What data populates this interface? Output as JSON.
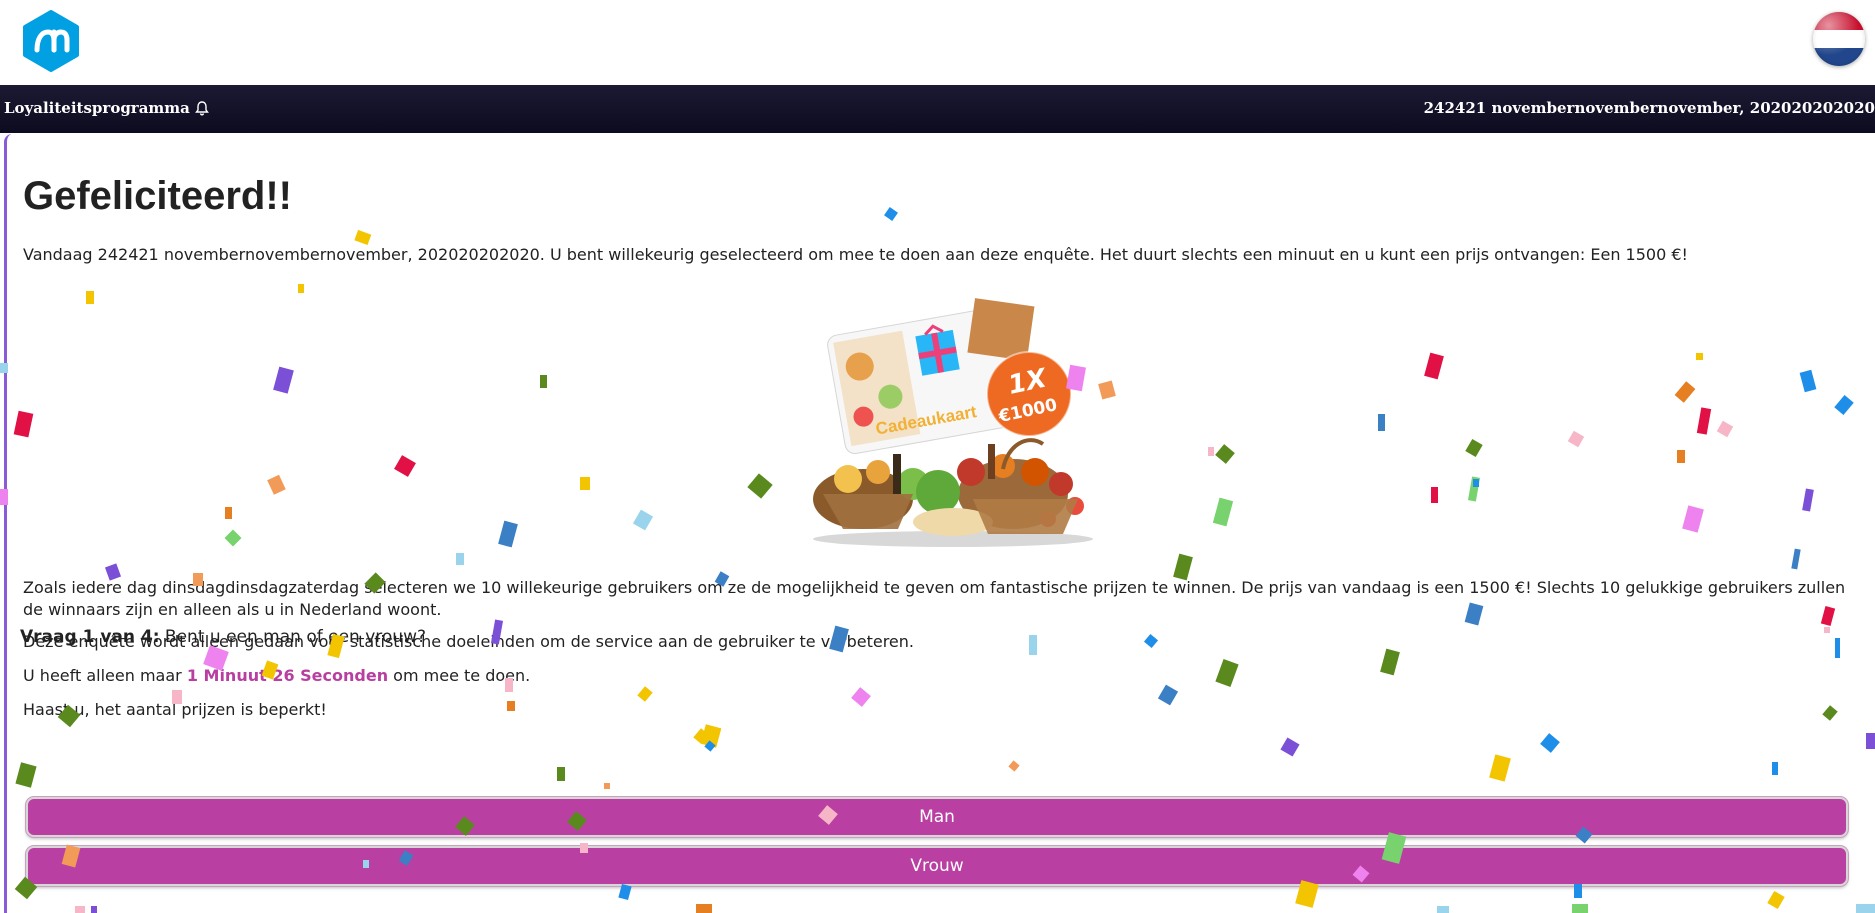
{
  "header": {
    "logo_icon": "albert-heijn-logo-icon",
    "flag_icon": "netherlands-flag-icon"
  },
  "navbar": {
    "program_label": "Loyaliteitsprogramma",
    "bell_icon": "bell-icon",
    "date_text": "242421 novembernovembernovember, 202020202020"
  },
  "main": {
    "title": "Gefeliciteerd!!",
    "intro": "Vandaag 242421 novembernovembernovember, 202020202020. U bent willekeurig geselecteerd om mee te doen aan deze enquête. Het duurt slechts een minuut en u kunt een prijs ontvangen: Een 1500 €!",
    "prize_card_label": "Cadeaukaart",
    "prize_badge_top": "1X",
    "prize_badge_bottom": "€1000",
    "paragraph1": "Zoals iedere dag dinsdagdinsdagzaterdag selecteren we 10 willekeurige gebruikers om ze de mogelijkheid te geven om fantastische prijzen te winnen. De prijs van vandaag is een 1500 €! Slechts 10 gelukkige gebruikers zullen de winnaars zijn en alleen als u in Nederland woont.",
    "paragraph2": "Deze enquête wordt alleen gedaan voor statistische doeleinden om de service aan de gebruiker te verbeteren.",
    "timer_prefix": "U heeft alleen maar ",
    "timer_value": "1 Minuut 26 Seconden",
    "timer_suffix": " om mee te doen.",
    "paragraph4": "Haast u, het aantal prijzen is beperkt!"
  },
  "question": {
    "label": "Vraag 1 van 4:",
    "text": " Bent u een man of een vrouw?",
    "options": [
      "Man",
      "Vrouw"
    ]
  },
  "colors": {
    "accent": "#ba3fa2",
    "navbar": "#0d0b1f",
    "logo_blue": "#00a0e2"
  }
}
